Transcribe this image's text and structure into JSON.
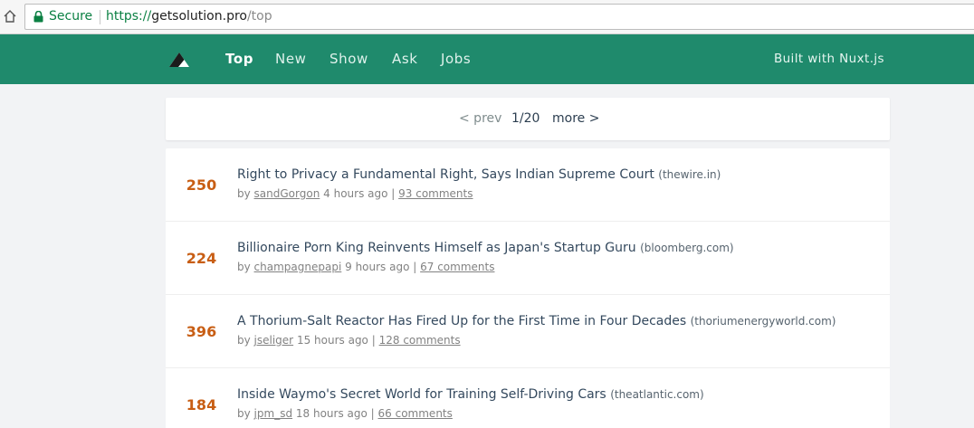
{
  "browser": {
    "secure_label": "Secure",
    "url_scheme": "https://",
    "url_host": "getsolution.pro",
    "url_path": "/top"
  },
  "header": {
    "nav": [
      "Top",
      "New",
      "Show",
      "Ask",
      "Jobs"
    ],
    "active": "Top",
    "built_with": "Built with Nuxt.js",
    "color": "#1f8a6c"
  },
  "pager": {
    "prev": "< prev",
    "page": "1/20",
    "more": "more >"
  },
  "items": [
    {
      "score": "250",
      "title": "Right to Privacy a Fundamental Right, Says Indian Supreme Court",
      "host": "(thewire.in)",
      "by": "by",
      "user": "sandGorgon",
      "time": "4 hours ago |",
      "comments": "93 comments"
    },
    {
      "score": "224",
      "title": "Billionaire Porn King Reinvents Himself as Japan's Startup Guru",
      "host": "(bloomberg.com)",
      "by": "by",
      "user": "champagnepapi",
      "time": "9 hours ago |",
      "comments": "67 comments"
    },
    {
      "score": "396",
      "title": "A Thorium-Salt Reactor Has Fired Up for the First Time in Four Decades",
      "host": "(thoriumenergyworld.com)",
      "by": "by",
      "user": "jseliger",
      "time": "15 hours ago |",
      "comments": "128 comments"
    },
    {
      "score": "184",
      "title": "Inside Waymo's Secret World for Training Self-Driving Cars",
      "host": "(theatlantic.com)",
      "by": "by",
      "user": "jpm_sd",
      "time": "18 hours ago |",
      "comments": "66 comments"
    }
  ],
  "colors": {
    "score": "#c85e14",
    "secure": "#0b8043"
  }
}
